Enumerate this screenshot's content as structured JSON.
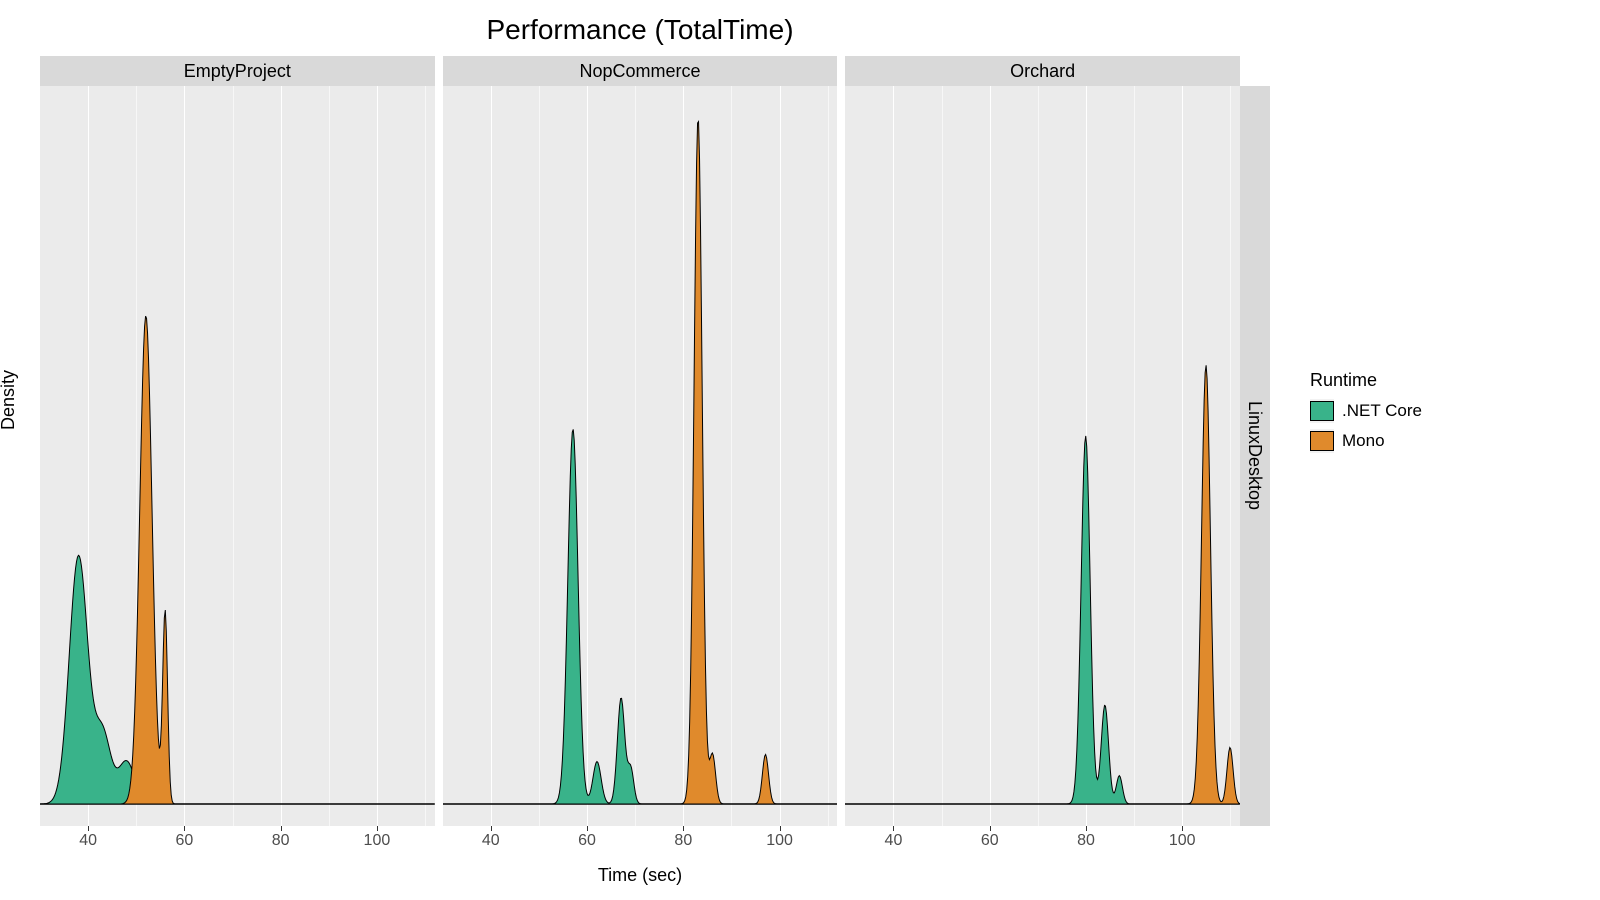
{
  "chart_data": {
    "type": "area",
    "title": "Performance (TotalTime)",
    "xlabel": "Time (sec)",
    "ylabel": "Density",
    "xlim": [
      30,
      112
    ],
    "x_ticks": [
      40,
      60,
      80,
      100
    ],
    "facet_row_label": "LinuxDesktop",
    "legend_title": "Runtime",
    "series_colors": {
      ".NET Core": "#39b38a",
      "Mono": "#e08a2c"
    },
    "facets": [
      {
        "label": "EmptyProject",
        "series": [
          {
            "name": ".NET Core",
            "peaks": [
              {
                "center": 38,
                "height": 0.35,
                "width": 4.5
              },
              {
                "center": 43,
                "height": 0.1,
                "width": 4.0
              },
              {
                "center": 48,
                "height": 0.06,
                "width": 4.0
              }
            ]
          },
          {
            "name": "Mono",
            "peaks": [
              {
                "center": 52,
                "height": 0.69,
                "width": 3.0
              },
              {
                "center": 56,
                "height": 0.27,
                "width": 1.2
              }
            ]
          }
        ]
      },
      {
        "label": "NopCommerce",
        "series": [
          {
            "name": ".NET Core",
            "peaks": [
              {
                "center": 57,
                "height": 0.53,
                "width": 2.5
              },
              {
                "center": 62,
                "height": 0.06,
                "width": 2.0
              },
              {
                "center": 67,
                "height": 0.15,
                "width": 1.8
              },
              {
                "center": 69,
                "height": 0.05,
                "width": 1.5
              }
            ]
          },
          {
            "name": "Mono",
            "peaks": [
              {
                "center": 83,
                "height": 0.97,
                "width": 2.0
              },
              {
                "center": 86,
                "height": 0.07,
                "width": 1.5
              },
              {
                "center": 97,
                "height": 0.07,
                "width": 1.5
              }
            ]
          }
        ]
      },
      {
        "label": "Orchard",
        "series": [
          {
            "name": ".NET Core",
            "peaks": [
              {
                "center": 80,
                "height": 0.52,
                "width": 2.2
              },
              {
                "center": 84,
                "height": 0.14,
                "width": 1.8
              },
              {
                "center": 87,
                "height": 0.04,
                "width": 1.5
              }
            ]
          },
          {
            "name": "Mono",
            "peaks": [
              {
                "center": 105,
                "height": 0.62,
                "width": 2.2
              },
              {
                "center": 110,
                "height": 0.08,
                "width": 1.5
              }
            ]
          }
        ]
      }
    ]
  }
}
